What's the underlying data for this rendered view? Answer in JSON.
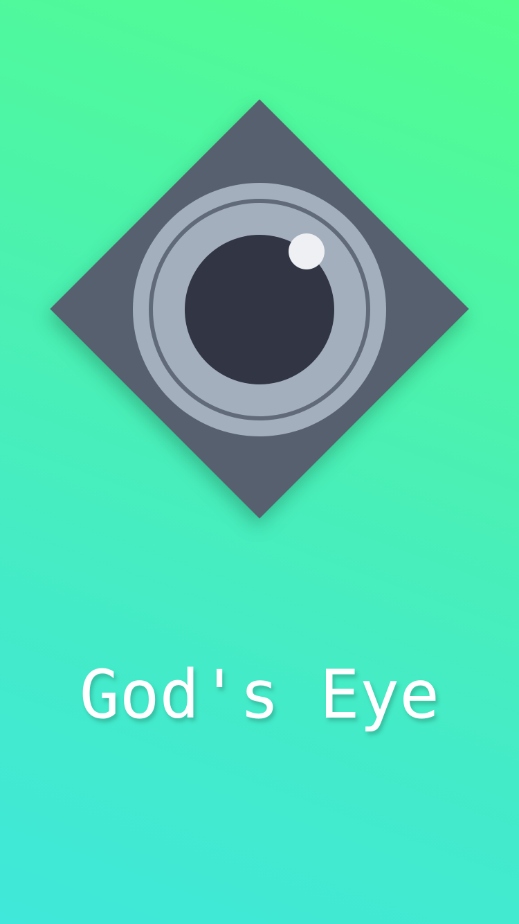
{
  "app": {
    "title": "God's Eye"
  },
  "logo": {
    "icon": "camera-lens-eye-icon"
  },
  "colors": {
    "background_top": "#52fe8e",
    "background_bottom": "#3fe8da",
    "diamond": "#57606e",
    "lens_ring": "#a3afbd",
    "pupil": "#313544",
    "glint": "#eef0f4",
    "title_text": "#ffffff"
  }
}
